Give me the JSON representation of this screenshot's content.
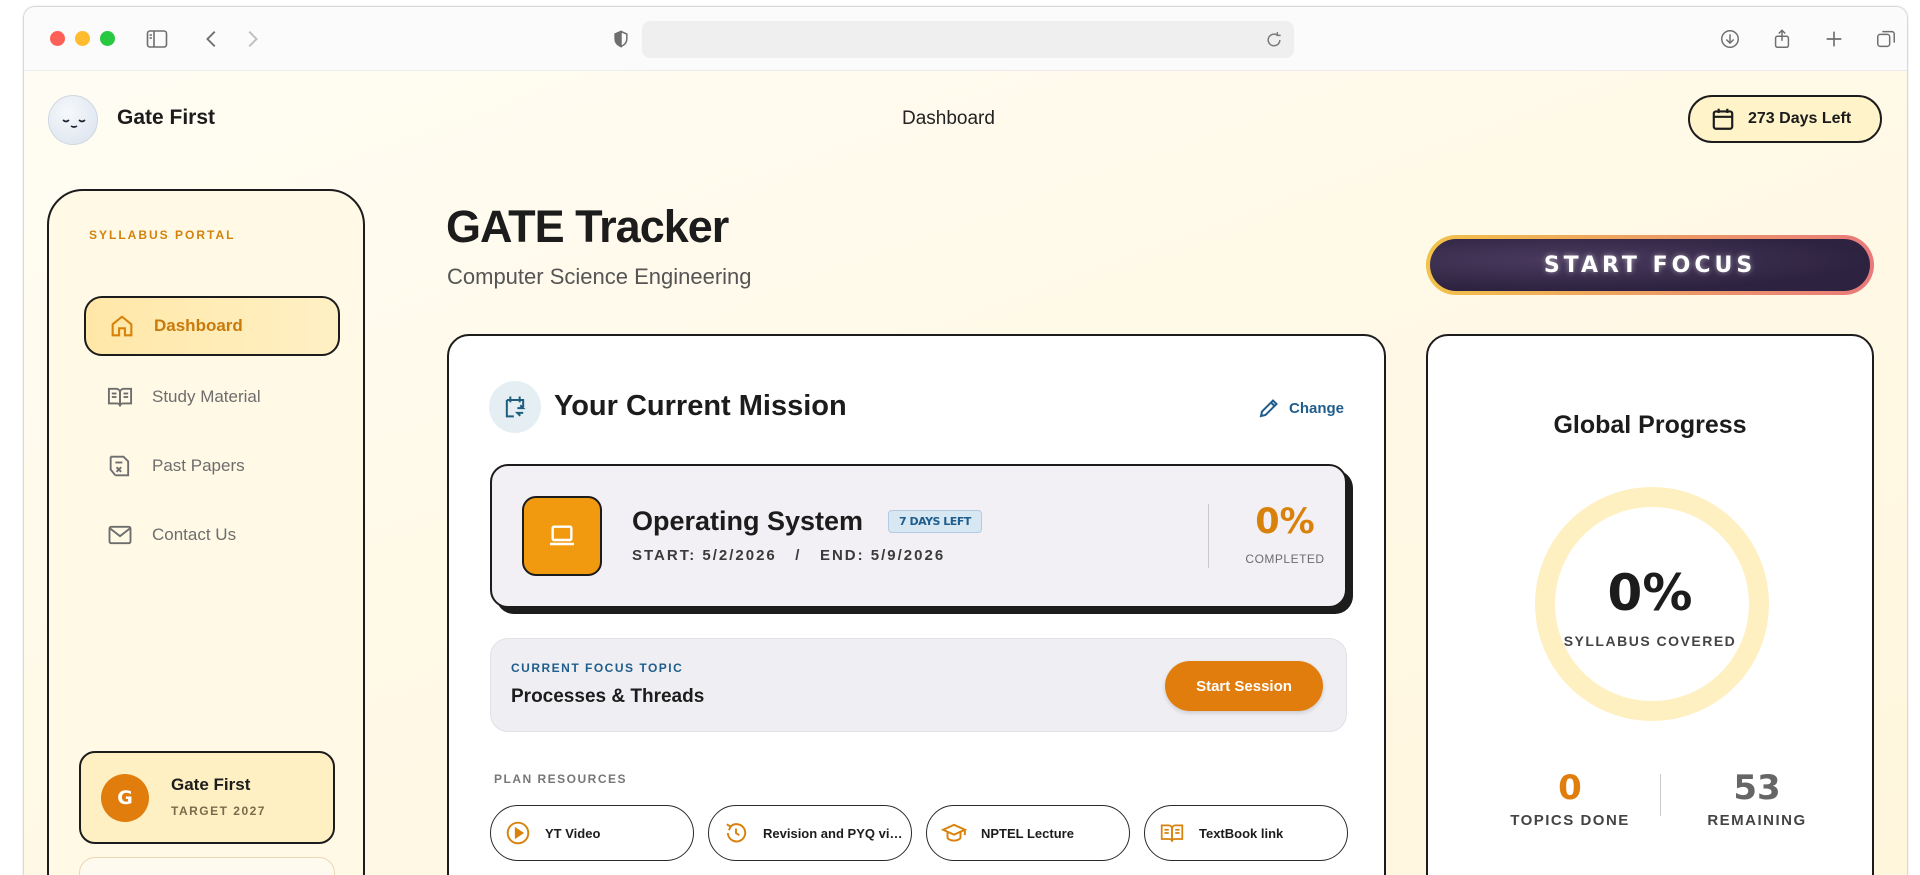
{
  "header": {
    "brand": "Gate First",
    "title": "Dashboard",
    "days_left": "273 Days Left"
  },
  "sidebar": {
    "portal_label": "SYLLABUS PORTAL",
    "items": [
      {
        "label": "Dashboard",
        "icon": "home-icon",
        "active": true
      },
      {
        "label": "Study Material",
        "icon": "book-icon"
      },
      {
        "label": "Past Papers",
        "icon": "papers-icon"
      },
      {
        "label": "Contact Us",
        "icon": "mail-icon"
      }
    ],
    "user": {
      "initial": "G",
      "name": "Gate First",
      "target": "TARGET 2027"
    }
  },
  "main": {
    "title": "GATE Tracker",
    "subtitle": "Computer Science Engineering",
    "start_focus": "START FOCUS"
  },
  "mission": {
    "title": "Your Current Mission",
    "change_label": "Change",
    "subject": {
      "name": "Operating System",
      "badge": "7 DAYS LEFT",
      "dates": "START: 5/2/2026   /   END: 5/9/2026",
      "percent": "0%",
      "completed_label": "COMPLETED"
    },
    "focus": {
      "label": "CURRENT FOCUS TOPIC",
      "topic": "Processes & Threads",
      "button": "Start Session"
    },
    "plan_label": "PLAN RESOURCES",
    "resources": [
      {
        "label": "YT Video",
        "icon": "play-icon"
      },
      {
        "label": "Revision and PYQ vid...",
        "icon": "history-icon"
      },
      {
        "label": "NPTEL Lecture",
        "icon": "graduation-cap-icon"
      },
      {
        "label": "TextBook link",
        "icon": "open-book-icon"
      }
    ]
  },
  "progress": {
    "title": "Global Progress",
    "percent": "0%",
    "covered_label": "SYLLABUS COVERED",
    "covered_fraction": 0,
    "topics_done_value": "0",
    "topics_done_label": "TOPICS DONE",
    "remaining_value": "53",
    "remaining_label": "REMAINING"
  },
  "colors": {
    "accent": "#e07d0d",
    "link": "#1f5d8c"
  }
}
